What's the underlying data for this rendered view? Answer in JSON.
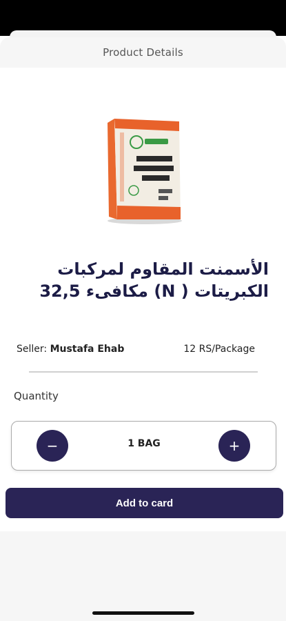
{
  "header": {
    "title": "Product Details"
  },
  "product": {
    "name": "الأسمنت المقاوم لمركبات الكبريتات ( N) مكافىء 32,5",
    "image_icon": "cement-bag-image",
    "bag_brand": "المدينة",
    "bag_text": "أسمنت بورتلاندي عادي",
    "seller_label": "Seller:",
    "seller_name": "Mustafa Ehab",
    "price": "12 RS/Package"
  },
  "quantity": {
    "label": "Quantity",
    "value": "1 BAG",
    "minus_label": "−",
    "plus_label": "+"
  },
  "actions": {
    "add_label": "Add to card"
  },
  "colors": {
    "accent": "#2a2456",
    "bag_orange": "#e8622b",
    "bag_green": "#3a9a45"
  }
}
